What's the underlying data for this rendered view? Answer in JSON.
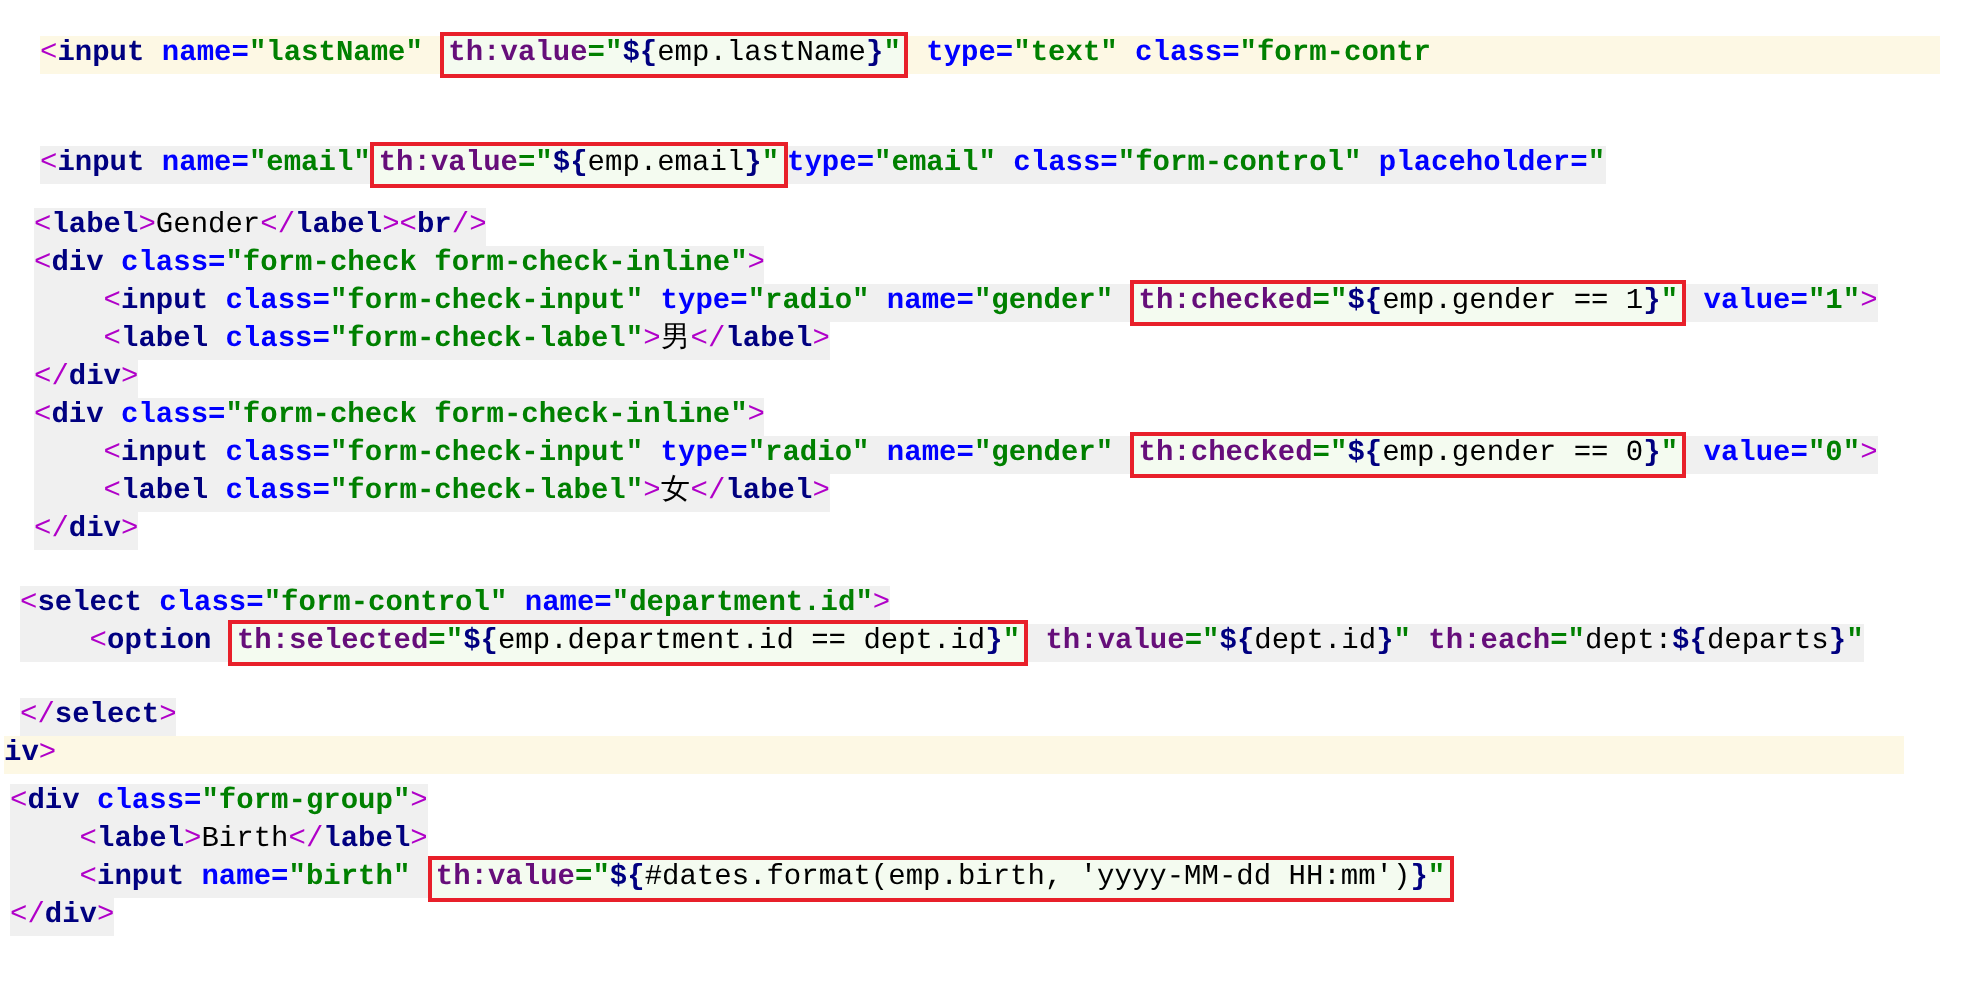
{
  "snippets": [
    {
      "lines": [
        {
          "current": true,
          "tokens": [
            {
              "kind": "punct",
              "text": "<"
            },
            {
              "kind": "tag",
              "text": "input"
            },
            {
              "kind": "attr",
              "text": " name="
            },
            {
              "kind": "str",
              "text": "\"lastName\" "
            },
            {
              "kind": "box",
              "tokens": [
                {
                  "kind": "th",
                  "text": "th:value"
                },
                {
                  "kind": "str",
                  "text": "=\""
                },
                {
                  "kind": "delim",
                  "text": "${"
                },
                {
                  "kind": "expr",
                  "text": "emp.lastName"
                },
                {
                  "kind": "delim",
                  "text": "}"
                },
                {
                  "kind": "str",
                  "text": "\""
                }
              ]
            },
            {
              "kind": "attr",
              "text": " type="
            },
            {
              "kind": "str",
              "text": "\"text\""
            },
            {
              "kind": "attr",
              "text": " class="
            },
            {
              "kind": "str",
              "text": "\"form-contr"
            }
          ]
        }
      ]
    },
    {
      "lines": [
        {
          "current": false,
          "tokens": [
            {
              "kind": "punct",
              "text": "<"
            },
            {
              "kind": "tag",
              "text": "input"
            },
            {
              "kind": "attr",
              "text": " name="
            },
            {
              "kind": "str",
              "text": "\"email\""
            },
            {
              "kind": "box",
              "tokens": [
                {
                  "kind": "th",
                  "text": "th:value"
                },
                {
                  "kind": "str",
                  "text": "=\""
                },
                {
                  "kind": "delim",
                  "text": "${"
                },
                {
                  "kind": "expr",
                  "text": "emp.email"
                },
                {
                  "kind": "delim",
                  "text": "}"
                },
                {
                  "kind": "str",
                  "text": "\""
                }
              ]
            },
            {
              "kind": "attr",
              "text": "type="
            },
            {
              "kind": "str",
              "text": "\"email\""
            },
            {
              "kind": "attr",
              "text": " class="
            },
            {
              "kind": "str",
              "text": "\"form-control\""
            },
            {
              "kind": "attr",
              "text": " placeholder="
            },
            {
              "kind": "str",
              "text": "\""
            }
          ]
        }
      ]
    },
    {
      "lines": [
        {
          "current": false,
          "tokens": [
            {
              "kind": "punct",
              "text": "<"
            },
            {
              "kind": "tag",
              "text": "label"
            },
            {
              "kind": "punct",
              "text": ">"
            },
            {
              "kind": "text",
              "text": "Gender"
            },
            {
              "kind": "punct",
              "text": "</"
            },
            {
              "kind": "tag",
              "text": "label"
            },
            {
              "kind": "punct",
              "text": "><"
            },
            {
              "kind": "tag",
              "text": "br"
            },
            {
              "kind": "punct",
              "text": "/>"
            }
          ]
        },
        {
          "current": false,
          "tokens": [
            {
              "kind": "punct",
              "text": "<"
            },
            {
              "kind": "tag",
              "text": "div"
            },
            {
              "kind": "attr",
              "text": " class="
            },
            {
              "kind": "str",
              "text": "\"form-check form-check-inline\""
            },
            {
              "kind": "punct",
              "text": ">"
            }
          ]
        },
        {
          "current": false,
          "tokens": [
            {
              "kind": "punct",
              "text": "    <"
            },
            {
              "kind": "tag",
              "text": "input"
            },
            {
              "kind": "attr",
              "text": " class="
            },
            {
              "kind": "str",
              "text": "\"form-check-input\""
            },
            {
              "kind": "attr",
              "text": " type="
            },
            {
              "kind": "str",
              "text": "\"radio\""
            },
            {
              "kind": "attr",
              "text": " name="
            },
            {
              "kind": "str",
              "text": "\"gender\" "
            },
            {
              "kind": "box",
              "tokens": [
                {
                  "kind": "th",
                  "text": "th:checked"
                },
                {
                  "kind": "str",
                  "text": "=\""
                },
                {
                  "kind": "delim",
                  "text": "${"
                },
                {
                  "kind": "expr",
                  "text": "emp.gender == 1"
                },
                {
                  "kind": "delim",
                  "text": "}"
                },
                {
                  "kind": "str",
                  "text": "\""
                }
              ]
            },
            {
              "kind": "attr",
              "text": " value="
            },
            {
              "kind": "str",
              "text": "\"1\""
            },
            {
              "kind": "punct",
              "text": ">"
            }
          ]
        },
        {
          "current": false,
          "tokens": [
            {
              "kind": "punct",
              "text": "    <"
            },
            {
              "kind": "tag",
              "text": "label"
            },
            {
              "kind": "attr",
              "text": " class="
            },
            {
              "kind": "str",
              "text": "\"form-check-label\""
            },
            {
              "kind": "punct",
              "text": ">"
            },
            {
              "kind": "text",
              "text": "男"
            },
            {
              "kind": "punct",
              "text": "</"
            },
            {
              "kind": "tag",
              "text": "label"
            },
            {
              "kind": "punct",
              "text": ">"
            }
          ]
        },
        {
          "current": false,
          "tokens": [
            {
              "kind": "punct",
              "text": "</"
            },
            {
              "kind": "tag",
              "text": "div"
            },
            {
              "kind": "punct",
              "text": ">"
            }
          ]
        },
        {
          "current": false,
          "tokens": [
            {
              "kind": "punct",
              "text": "<"
            },
            {
              "kind": "tag",
              "text": "div"
            },
            {
              "kind": "attr",
              "text": " class="
            },
            {
              "kind": "str",
              "text": "\"form-check form-check-inline\""
            },
            {
              "kind": "punct",
              "text": ">"
            }
          ]
        },
        {
          "current": false,
          "tokens": [
            {
              "kind": "punct",
              "text": "    <"
            },
            {
              "kind": "tag",
              "text": "input"
            },
            {
              "kind": "attr",
              "text": " class="
            },
            {
              "kind": "str",
              "text": "\"form-check-input\""
            },
            {
              "kind": "attr",
              "text": " type="
            },
            {
              "kind": "str",
              "text": "\"radio\""
            },
            {
              "kind": "attr",
              "text": " name="
            },
            {
              "kind": "str",
              "text": "\"gender\" "
            },
            {
              "kind": "box",
              "tokens": [
                {
                  "kind": "th",
                  "text": "th:checked"
                },
                {
                  "kind": "str",
                  "text": "=\""
                },
                {
                  "kind": "delim",
                  "text": "${"
                },
                {
                  "kind": "expr",
                  "text": "emp.gender == 0"
                },
                {
                  "kind": "delim",
                  "text": "}"
                },
                {
                  "kind": "str",
                  "text": "\""
                }
              ]
            },
            {
              "kind": "attr",
              "text": " value="
            },
            {
              "kind": "str",
              "text": "\"0\""
            },
            {
              "kind": "punct",
              "text": ">"
            }
          ]
        },
        {
          "current": false,
          "tokens": [
            {
              "kind": "punct",
              "text": "    <"
            },
            {
              "kind": "tag",
              "text": "label"
            },
            {
              "kind": "attr",
              "text": " class="
            },
            {
              "kind": "str",
              "text": "\"form-check-label\""
            },
            {
              "kind": "punct",
              "text": ">"
            },
            {
              "kind": "text",
              "text": "女"
            },
            {
              "kind": "punct",
              "text": "</"
            },
            {
              "kind": "tag",
              "text": "label"
            },
            {
              "kind": "punct",
              "text": ">"
            }
          ]
        },
        {
          "current": false,
          "tokens": [
            {
              "kind": "punct",
              "text": "</"
            },
            {
              "kind": "tag",
              "text": "div"
            },
            {
              "kind": "punct",
              "text": ">"
            }
          ]
        }
      ]
    },
    {
      "lines": [
        {
          "current": false,
          "tokens": [
            {
              "kind": "punct",
              "text": "<"
            },
            {
              "kind": "tag",
              "text": "select"
            },
            {
              "kind": "attr",
              "text": " class="
            },
            {
              "kind": "str",
              "text": "\"form-control\""
            },
            {
              "kind": "attr",
              "text": " name="
            },
            {
              "kind": "str",
              "text": "\"department.id\""
            },
            {
              "kind": "punct",
              "text": ">"
            }
          ]
        },
        {
          "current": false,
          "tokens": [
            {
              "kind": "punct",
              "text": "    <"
            },
            {
              "kind": "tag",
              "text": "option "
            },
            {
              "kind": "box",
              "tokens": [
                {
                  "kind": "th",
                  "text": "th:selected"
                },
                {
                  "kind": "str",
                  "text": "=\""
                },
                {
                  "kind": "delim",
                  "text": "${"
                },
                {
                  "kind": "expr",
                  "text": "emp.department.id == dept.id"
                },
                {
                  "kind": "delim",
                  "text": "}"
                },
                {
                  "kind": "str",
                  "text": "\""
                }
              ]
            },
            {
              "kind": "th",
              "text": " th:value"
            },
            {
              "kind": "str",
              "text": "=\""
            },
            {
              "kind": "delim",
              "text": "${"
            },
            {
              "kind": "expr",
              "text": "dept.id"
            },
            {
              "kind": "delim",
              "text": "}"
            },
            {
              "kind": "str",
              "text": "\""
            },
            {
              "kind": "th",
              "text": " th:each"
            },
            {
              "kind": "str",
              "text": "=\""
            },
            {
              "kind": "expr",
              "text": "dept:"
            },
            {
              "kind": "delim",
              "text": "${"
            },
            {
              "kind": "expr",
              "text": "departs"
            },
            {
              "kind": "delim",
              "text": "}"
            },
            {
              "kind": "str",
              "text": "\""
            }
          ]
        }
      ]
    },
    {
      "lines": [
        {
          "current": false,
          "tokens": [
            {
              "kind": "punct",
              "text": "</"
            },
            {
              "kind": "tag",
              "text": "select"
            },
            {
              "kind": "punct",
              "text": ">"
            }
          ]
        }
      ]
    },
    {
      "lines": [
        {
          "current": true,
          "tokens": [
            {
              "kind": "tag",
              "text": "iv"
            },
            {
              "kind": "punct",
              "text": ">"
            }
          ]
        }
      ]
    },
    {
      "lines": [
        {
          "current": false,
          "tokens": [
            {
              "kind": "punct",
              "text": "<"
            },
            {
              "kind": "tag",
              "text": "div"
            },
            {
              "kind": "attr",
              "text": " class="
            },
            {
              "kind": "str",
              "text": "\"form-group\""
            },
            {
              "kind": "punct",
              "text": ">"
            }
          ]
        },
        {
          "current": false,
          "tokens": [
            {
              "kind": "punct",
              "text": "    <"
            },
            {
              "kind": "tag",
              "text": "label"
            },
            {
              "kind": "punct",
              "text": ">"
            },
            {
              "kind": "text",
              "text": "Birth"
            },
            {
              "kind": "punct",
              "text": "</"
            },
            {
              "kind": "tag",
              "text": "label"
            },
            {
              "kind": "punct",
              "text": ">"
            }
          ]
        },
        {
          "current": false,
          "tokens": [
            {
              "kind": "punct",
              "text": "    <"
            },
            {
              "kind": "tag",
              "text": "input"
            },
            {
              "kind": "attr",
              "text": " name="
            },
            {
              "kind": "str",
              "text": "\"birth\" "
            },
            {
              "kind": "box",
              "tokens": [
                {
                  "kind": "th",
                  "text": "th:value"
                },
                {
                  "kind": "str",
                  "text": "=\""
                },
                {
                  "kind": "delim",
                  "text": "${"
                },
                {
                  "kind": "expr",
                  "text": "#dates.format(emp.birth, 'yyyy-MM-dd HH:mm')"
                },
                {
                  "kind": "delim",
                  "text": "}"
                },
                {
                  "kind": "str",
                  "text": "\""
                }
              ]
            }
          ]
        },
        {
          "current": false,
          "tokens": [
            {
              "kind": "punct",
              "text": "</"
            },
            {
              "kind": "tag",
              "text": "div"
            },
            {
              "kind": "punct",
              "text": ">"
            }
          ]
        }
      ]
    }
  ]
}
